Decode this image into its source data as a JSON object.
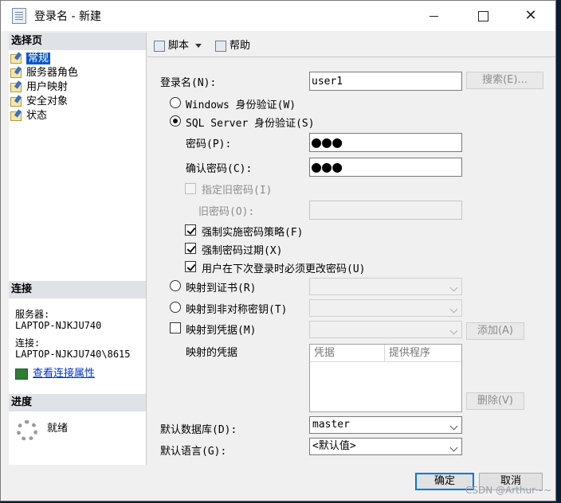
{
  "window": {
    "title": "登录名 - 新建",
    "controls": {
      "minimize_icon": "minimize-icon",
      "maximize_icon": "maximize-icon",
      "close_icon": "close-icon"
    }
  },
  "left_pane": {
    "select_page_header": "选择页",
    "pages": [
      {
        "label": "常规",
        "selected": true
      },
      {
        "label": "服务器角色",
        "selected": false
      },
      {
        "label": "用户映射",
        "selected": false
      },
      {
        "label": "安全对象",
        "selected": false
      },
      {
        "label": "状态",
        "selected": false
      }
    ],
    "connection_header": "连接",
    "server_label": "服务器:",
    "server_value": "LAPTOP-NJKJU740",
    "connection_label": "连接:",
    "connection_value": "LAPTOP-NJKJU740\\8615",
    "view_properties_link": "查看连接属性",
    "progress_header": "进度",
    "progress_status": "就绪"
  },
  "toolbar": {
    "script_label": "脚本",
    "help_label": "帮助"
  },
  "form": {
    "login_name_label": "登录名(N):",
    "login_name_value": "user1",
    "search_button": "搜索(E)...",
    "windows_auth_label": "Windows 身份验证(W)",
    "sql_auth_label": "SQL Server 身份验证(S)",
    "password_label": "密码(P):",
    "password_value": "●●●",
    "confirm_password_label": "确认密码(C):",
    "confirm_password_value": "●●●",
    "specify_old_password_label": "指定旧密码(I)",
    "old_password_label": "旧密码(O):",
    "enforce_policy_label": "强制实施密码策略(F)",
    "enforce_expiration_label": "强制密码过期(X)",
    "must_change_label": "用户在下次登录时必须更改密码(U)",
    "map_certificate_label": "映射到证书(R)",
    "map_asymmetric_key_label": "映射到非对称密钥(T)",
    "map_credential_label": "映射到凭据(M)",
    "add_button": "添加(A)",
    "mapped_credentials_label": "映射的凭据",
    "grid_headers": [
      "凭据",
      "提供程序"
    ],
    "remove_button": "删除(V)",
    "default_database_label": "默认数据库(D):",
    "default_database_value": "master",
    "default_language_label": "默认语言(G):",
    "default_language_value": "<默认值>"
  },
  "footer": {
    "ok_button": "确定",
    "cancel_button": "取消"
  },
  "watermark": "CSDN @Arthur~~"
}
